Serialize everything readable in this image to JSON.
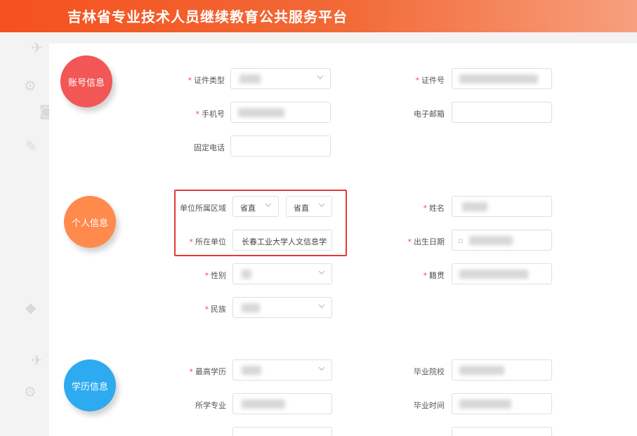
{
  "header": {
    "title": "吉林省专业技术人员继续教育公共服务平台"
  },
  "sections": {
    "account": "账号信息",
    "personal": "个人信息",
    "education": "学历信息"
  },
  "labels": {
    "id_type": "证件类型",
    "id_number": "证件号",
    "phone": "手机号",
    "email": "电子邮箱",
    "landline": "固定电话",
    "unit_region": "单位所属区域",
    "name": "姓名",
    "unit": "所在单位",
    "birth_date": "出生日期",
    "gender": "性别",
    "native_place": "籍贯",
    "ethnicity": "民族",
    "highest_degree": "最高学历",
    "school": "毕业院校",
    "major": "所学专业",
    "grad_time": "毕业时间"
  },
  "values": {
    "region_province": "省直",
    "region_city": "省直",
    "unit": "长春工业大学人文信息学院"
  },
  "colors": {
    "header": "#f4511e",
    "account_circle": "#f25756",
    "personal_circle": "#ff8a4c",
    "education_circle": "#2eaaf0",
    "highlight_border": "#e53935"
  }
}
